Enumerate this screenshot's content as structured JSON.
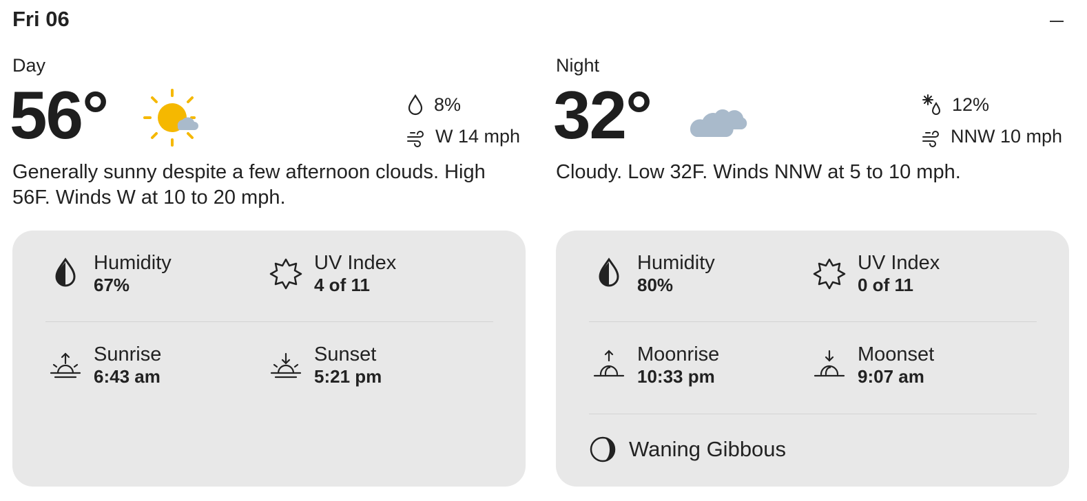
{
  "header": {
    "date": "Fri 06"
  },
  "day": {
    "period": "Day",
    "temp": "56°",
    "condition_icon": "sunny-partly-cloudy-icon",
    "precip": "8%",
    "precip_icon": "raindrop-icon",
    "wind": "W 14 mph",
    "wind_icon": "wind-icon",
    "description": "Generally sunny despite a few afternoon clouds. High 56F. Winds W at 10 to 20 mph.",
    "details": {
      "humidity_label": "Humidity",
      "humidity_value": "67%",
      "uv_label": "UV Index",
      "uv_value": "4 of 11",
      "rise_label": "Sunrise",
      "rise_value": "6:43 am",
      "set_label": "Sunset",
      "set_value": "5:21 pm"
    }
  },
  "night": {
    "period": "Night",
    "temp": "32°",
    "condition_icon": "cloudy-icon",
    "precip": "12%",
    "precip_icon": "snow-rain-icon",
    "wind": "NNW 10 mph",
    "wind_icon": "wind-icon",
    "description": "Cloudy. Low 32F. Winds NNW at 5 to 10 mph.",
    "details": {
      "humidity_label": "Humidity",
      "humidity_value": "80%",
      "uv_label": "UV Index",
      "uv_value": "0 of 11",
      "rise_label": "Moonrise",
      "rise_value": "10:33 pm",
      "set_label": "Moonset",
      "set_value": "9:07 am",
      "moon_phase": "Waning Gibbous"
    }
  },
  "colors": {
    "sun": "#F5B800",
    "cloud": "#A9BACB",
    "card_bg": "#E8E8E8",
    "text": "#222222"
  }
}
